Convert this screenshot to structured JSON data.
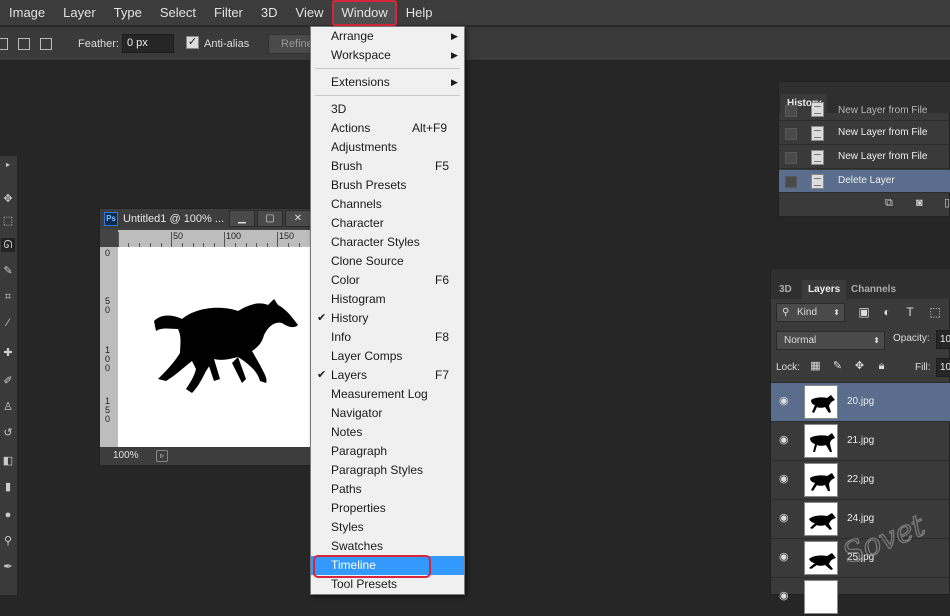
{
  "menubar": {
    "items": [
      "Image",
      "Layer",
      "Type",
      "Select",
      "Filter",
      "3D",
      "View",
      "Window",
      "Help"
    ],
    "active": "Window"
  },
  "options": {
    "feather_label": "Feather:",
    "feather_value": "0 px",
    "antialias_label": "Anti-alias",
    "antialias_checked": true,
    "refine_label": "Refine"
  },
  "document": {
    "title": "Untitled1 @ 100% ...",
    "app_icon": "Ps",
    "zoom": "100%",
    "ruler_top": [
      "50",
      "100",
      "150"
    ],
    "ruler_left": [
      "0",
      "5\n0",
      "1\n0\n0",
      "1\n5\n0"
    ]
  },
  "window_menu": {
    "items": [
      {
        "label": "Arrange",
        "submenu": true
      },
      {
        "label": "Workspace",
        "submenu": true
      },
      {
        "separator": true
      },
      {
        "label": "Extensions",
        "submenu": true
      },
      {
        "separator": true
      },
      {
        "label": "3D"
      },
      {
        "label": "Actions",
        "shortcut": "Alt+F9"
      },
      {
        "label": "Adjustments"
      },
      {
        "label": "Brush",
        "shortcut": "F5"
      },
      {
        "label": "Brush Presets"
      },
      {
        "label": "Channels"
      },
      {
        "label": "Character"
      },
      {
        "label": "Character Styles"
      },
      {
        "label": "Clone Source"
      },
      {
        "label": "Color",
        "shortcut": "F6"
      },
      {
        "label": "Histogram"
      },
      {
        "label": "History",
        "checked": true
      },
      {
        "label": "Info",
        "shortcut": "F8"
      },
      {
        "label": "Layer Comps"
      },
      {
        "label": "Layers",
        "shortcut": "F7",
        "checked": true
      },
      {
        "label": "Measurement Log"
      },
      {
        "label": "Navigator"
      },
      {
        "label": "Notes"
      },
      {
        "label": "Paragraph"
      },
      {
        "label": "Paragraph Styles"
      },
      {
        "label": "Paths"
      },
      {
        "label": "Properties"
      },
      {
        "label": "Styles"
      },
      {
        "label": "Swatches"
      },
      {
        "label": "Timeline",
        "highlighted": true
      },
      {
        "label": "Tool Presets"
      }
    ]
  },
  "history": {
    "tab": "History",
    "rows": [
      {
        "label": "New Layer from File"
      },
      {
        "label": "New Layer from File"
      },
      {
        "label": "New Layer from File"
      },
      {
        "label": "Delete Layer",
        "selected": true
      }
    ]
  },
  "layers": {
    "tabs": [
      "3D",
      "Layers",
      "Channels"
    ],
    "active_tab": "Layers",
    "kind_label": "Kind",
    "blend_mode": "Normal",
    "opacity_label": "Opacity:",
    "opacity_value": "10",
    "lock_label": "Lock:",
    "fill_label": "Fill:",
    "fill_value": "10",
    "rows": [
      {
        "name": "20.jpg",
        "selected": true
      },
      {
        "name": "21.jpg"
      },
      {
        "name": "22.jpg"
      },
      {
        "name": "24.jpg"
      },
      {
        "name": "25.jpg"
      }
    ]
  },
  "watermark": "Sovet",
  "colors": {
    "accent_highlight": "#3399ff",
    "annotation_red": "#d6263a",
    "selection_blue": "#5a6d8c"
  }
}
